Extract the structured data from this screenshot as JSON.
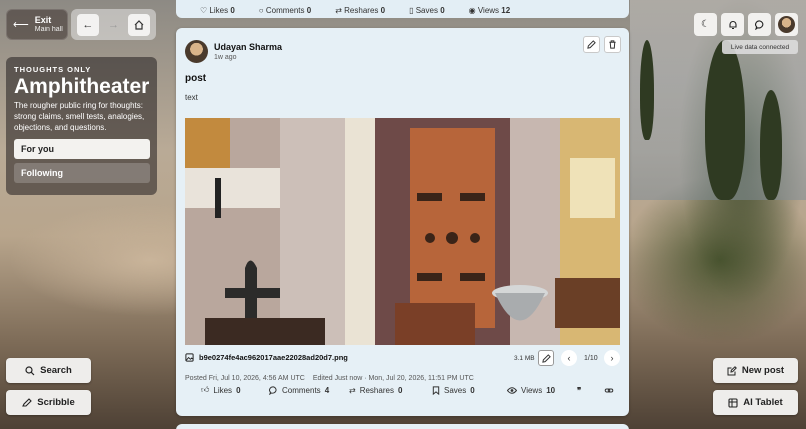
{
  "nav": {
    "exit_label": "Exit",
    "exit_sub": "Main hall",
    "back_icon": "arrow-left-icon",
    "forward_icon": "arrow-right-icon",
    "home_icon": "home-icon"
  },
  "space": {
    "kicker": "THOUGHTS ONLY",
    "title": "Amphitheater",
    "description": "The rougher public ring for thoughts: strong claims, smell tests, analogies, objections, and questions.",
    "tabs": [
      {
        "label": "For you",
        "active": true
      },
      {
        "label": "Following",
        "active": false
      }
    ]
  },
  "left_actions": {
    "search_label": "Search",
    "scribble_label": "Scribble"
  },
  "right_actions": {
    "live_status": "Live data connected",
    "new_post_label": "New post",
    "ai_tablet_label": "AI Tablet"
  },
  "previous_post": {
    "likes_label": "Likes",
    "likes": "0",
    "comments_label": "Comments",
    "comments": "0",
    "reshares_label": "Reshares",
    "reshares": "0",
    "saves_label": "Saves",
    "saves": "0",
    "views_label": "Views",
    "views": "12"
  },
  "post": {
    "author": "Udayan Sharma",
    "time_ago": "1w ago",
    "title": "post",
    "body": "text",
    "attachment": {
      "filename": "b9e0274fe4ac962017aae22028ad20d7.png",
      "size": "3.1 MB",
      "page": "1/10"
    },
    "posted": "Posted Fri, Jul 10, 2026, 4:56 AM UTC",
    "edited": "Edited Just now · Mon, Jul 20, 2026, 11:51 PM UTC",
    "stats": {
      "likes_label": "Likes",
      "likes": "0",
      "comments_label": "Comments",
      "comments": "4",
      "reshares_label": "Reshares",
      "reshares": "0",
      "saves_label": "Saves",
      "saves": "0",
      "views_label": "Views",
      "views": "10"
    }
  }
}
